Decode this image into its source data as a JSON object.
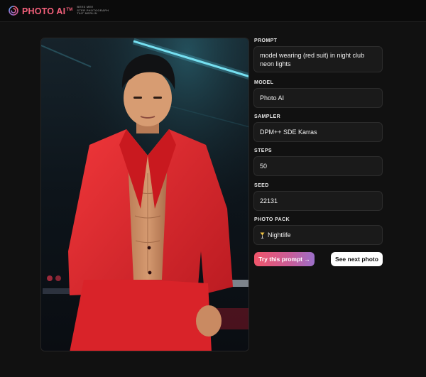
{
  "header": {
    "brand": "PHOTO AI",
    "brand_tm": "TM",
    "tagline_lines": [
      "BEES MEE",
      "STER PHOTOGRAPH",
      "TAIT MERLIN"
    ],
    "logo_icon": "swirl-logo-icon",
    "brand_color": "#f2607a"
  },
  "image": {
    "subject": "model wearing red suit in night club neon lights",
    "accent_colors": {
      "suit": "#e1262b",
      "neon": "#5ad1e8",
      "background": "#0c1116"
    }
  },
  "form": {
    "prompt": {
      "label": "PROMPT",
      "value": "model wearing (red suit) in night club neon lights"
    },
    "model": {
      "label": "MODEL",
      "value": "Photo AI"
    },
    "sampler": {
      "label": "SAMPLER",
      "value": "DPM++ SDE Karras"
    },
    "steps": {
      "label": "STEPS",
      "value": "50"
    },
    "seed": {
      "label": "SEED",
      "value": "22131"
    },
    "photo_pack": {
      "label": "PHOTO PACK",
      "value": "Nightlife",
      "icon": "cocktail-glass-icon"
    }
  },
  "actions": {
    "try_prompt": "Try this prompt →",
    "next_photo": "See next photo"
  }
}
